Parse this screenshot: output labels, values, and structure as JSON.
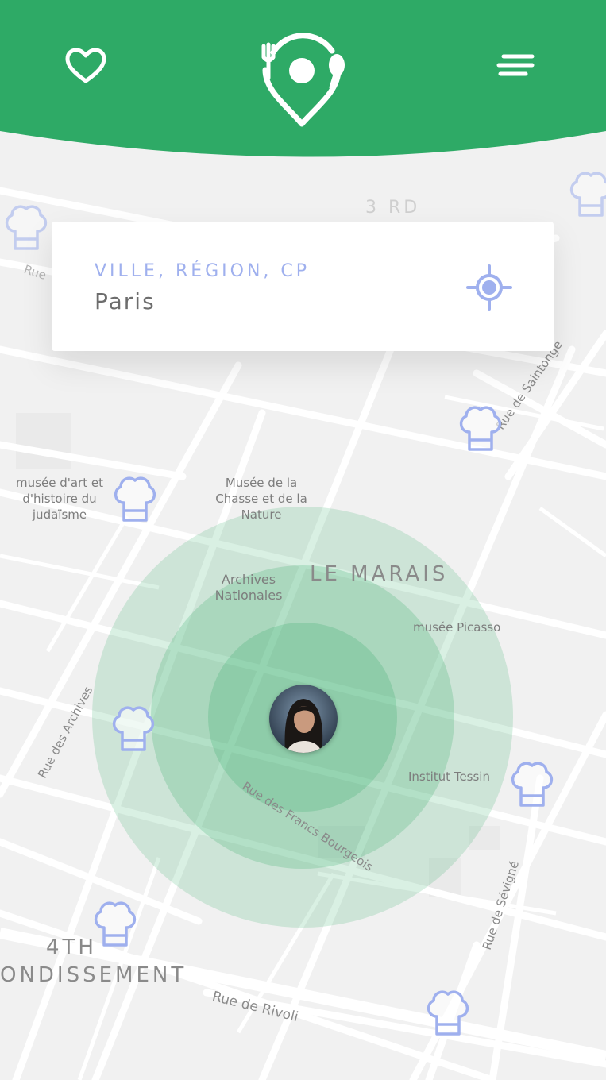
{
  "search": {
    "label": "VILLE, RÉGION, CP",
    "value": "Paris"
  },
  "map": {
    "places": [
      {
        "id": "musee-art",
        "text": "musée d'art et d'histoire du judaïsme"
      },
      {
        "id": "musee-chasse",
        "text": "Musée de la Chasse et de la Nature"
      },
      {
        "id": "archives",
        "text": "Archives Nationales"
      },
      {
        "id": "picasso",
        "text": "musée Picasso"
      },
      {
        "id": "tessin",
        "text": "Institut Tessin"
      }
    ],
    "districts": {
      "marais": "LE MARAIS",
      "fourth_a": "4TH",
      "fourth_b": "ONDISSEMENT",
      "third": "3 RD"
    },
    "streets": {
      "saintonge": "Rue de Saintonge",
      "archives": "Rue des Archives",
      "francs": "Rue des Francs Bourgeois",
      "sevigne": "Rue de Sévigné",
      "rivoli": "Rue de Rivoli",
      "rue_top": "Rue"
    }
  },
  "colors": {
    "header": "#2eaa66",
    "accent": "#9fb0ee",
    "radius": "#2eaa66"
  },
  "icons": [
    "heart-icon",
    "app-logo",
    "menu-icon",
    "crosshair-icon",
    "chef-hat-icon"
  ]
}
